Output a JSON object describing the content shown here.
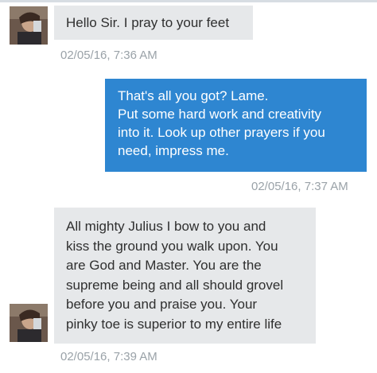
{
  "messages": [
    {
      "direction": "incoming",
      "lines": [
        "Hello Sir. I pray to your feet"
      ],
      "timestamp": "02/05/16, 7:36 AM"
    },
    {
      "direction": "outgoing",
      "lines": [
        "That's all you got? Lame.",
        "Put some hard work and creativity",
        "into it. Look up other prayers if you",
        "need, impress me."
      ],
      "timestamp": "02/05/16, 7:37 AM"
    },
    {
      "direction": "incoming",
      "lines": [
        "All mighty Julius I bow to you and",
        "kiss the ground you walk upon. You",
        "are God and Master. You are the",
        "supreme being and all should grovel",
        "before you and praise you. Your",
        "pinky toe is superior to my entire life"
      ],
      "timestamp": "02/05/16, 7:39 AM"
    }
  ],
  "colors": {
    "incoming_bubble": "#e6e8ea",
    "outgoing_bubble": "#2e86d1",
    "timestamp": "#9aa2a8"
  },
  "icons": {
    "sender_avatar": "contact-photo"
  }
}
